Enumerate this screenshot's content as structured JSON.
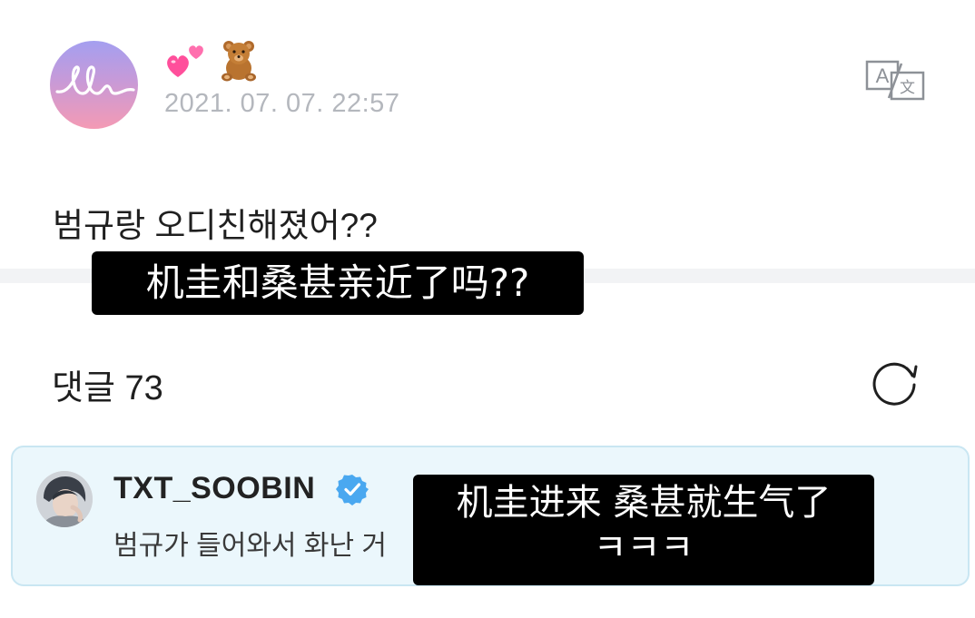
{
  "post": {
    "author_emoji": "💕🧸",
    "date": "2021. 07. 07. 22:57",
    "text": "범규랑 오디친해졌어??",
    "subtitle": "机圭和桑甚亲近了吗??"
  },
  "icons": {
    "translate": "translate-icon",
    "refresh": "refresh-icon",
    "verified": "verified-badge-icon",
    "hearts": "two-hearts-icon",
    "bear": "teddy-bear-icon"
  },
  "comments": {
    "label": "댓글 73",
    "items": [
      {
        "author": "TXT_SOOBIN",
        "verified": true,
        "text": "범규가 들어와서 화난 거",
        "subtitle_line1": "机圭进来 桑甚就生气了",
        "subtitle_line2": "ㅋㅋㅋ"
      }
    ]
  },
  "colors": {
    "date_gray": "#b4b7bd",
    "card_background": "#ebf7fc",
    "card_border": "#c9e6f2",
    "verified_blue": "#4aa8f0",
    "avatar_gradient_top": "#a49ff0",
    "avatar_gradient_bottom": "#f49ab4"
  }
}
